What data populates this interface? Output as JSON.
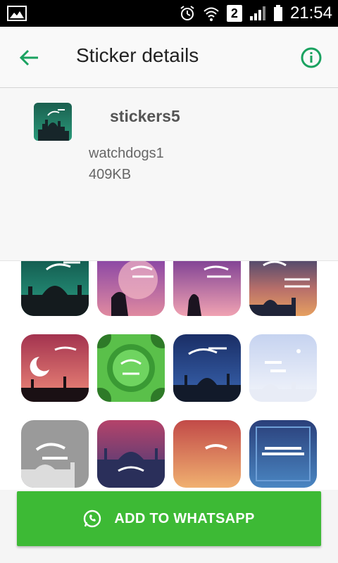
{
  "status_bar": {
    "time": "21:54",
    "sim_slot": "2"
  },
  "app_bar": {
    "title": "Sticker details",
    "back_icon": "arrow-left-icon",
    "info_icon": "info-icon",
    "accent": "#1aa260"
  },
  "pack": {
    "name": "stickers5",
    "publisher": "watchdogs1",
    "size": "409KB"
  },
  "add_button": {
    "label": "ADD TO WHATSAPP",
    "color": "#3dba35",
    "icon": "whatsapp-icon"
  },
  "stickers": [
    {
      "theme": "ramadan-kareem-teal"
    },
    {
      "theme": "qiyam-purple"
    },
    {
      "theme": "prayer-purple"
    },
    {
      "theme": "eid-orange-night"
    },
    {
      "theme": "eid-mubarak-pink"
    },
    {
      "theme": "eid-green-ornament"
    },
    {
      "theme": "eid-blue-mosque"
    },
    {
      "theme": "eid-white-blue"
    },
    {
      "theme": "eid-gray-white"
    },
    {
      "theme": "ramadan-mosque-pink"
    },
    {
      "theme": "ramadan-crescent-gold"
    },
    {
      "theme": "shahada-blue"
    }
  ]
}
